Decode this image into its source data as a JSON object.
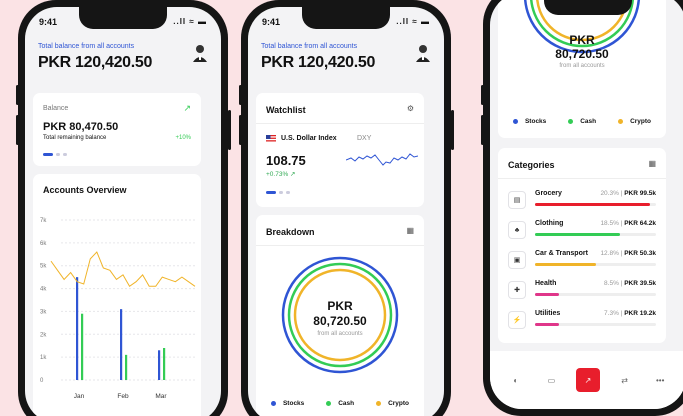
{
  "status": {
    "time": "9:41",
    "icons": "..ll ≈ ▬"
  },
  "balance": {
    "label": "Total balance from all accounts",
    "amount": "PKR 120,420.50"
  },
  "balance_card": {
    "label": "Balance",
    "amount": "PKR 80,470.50",
    "sub": "Total remaining balance",
    "change": "+10%"
  },
  "accounts_overview": {
    "title": "Accounts Overview"
  },
  "chart_data": {
    "type": "bar",
    "title": "Accounts Overview",
    "y_ticks": [
      "7k",
      "6k",
      "5k",
      "4k",
      "3k",
      "2k",
      "1k",
      "0"
    ],
    "x_ticks": [
      "Jan",
      "Feb",
      "Mar"
    ],
    "ylim": [
      0,
      7000
    ],
    "bars": [
      {
        "month": "Jan",
        "blue": 4500,
        "green": 2900
      },
      {
        "month": "Feb",
        "blue": 3100,
        "green": 1100
      },
      {
        "month": "Mar",
        "blue": 1300,
        "green": 1400
      }
    ],
    "line": [
      5200,
      4800,
      4400,
      4700,
      4300,
      4200,
      5300,
      5600,
      4900,
      4800,
      4400,
      4600,
      4100,
      4300,
      4600,
      4100,
      4100,
      4500,
      4400,
      4300,
      4500,
      4300,
      4100
    ],
    "colors": {
      "line": "#f0b429",
      "blue": "#2f55d4",
      "green": "#33cc55"
    }
  },
  "watchlist": {
    "title": "Watchlist",
    "name": "U.S. Dollar Index",
    "ticker": "DXY",
    "value": "108.75",
    "change": "+0.73%"
  },
  "breakdown": {
    "title": "Breakdown",
    "currency": "PKR",
    "amount": "80,720.50",
    "sub": "from all accounts"
  },
  "legend": [
    {
      "label": "Stocks",
      "color": "#2f55d4"
    },
    {
      "label": "Cash",
      "color": "#33cc55"
    },
    {
      "label": "Crypto",
      "color": "#f0b429"
    }
  ],
  "categories": {
    "title": "Categories",
    "items": [
      {
        "name": "Grocery",
        "pct": "20.3%",
        "amount": "PKR 99.5k",
        "fill": 0.95,
        "color": "#e81e2c",
        "icon": "cart-icon",
        "glyph": "▤"
      },
      {
        "name": "Clothing",
        "pct": "18.5%",
        "amount": "PKR 64.2k",
        "fill": 0.7,
        "color": "#33cc55",
        "icon": "shirt-icon",
        "glyph": "♣"
      },
      {
        "name": "Car & Transport",
        "pct": "12.8%",
        "amount": "PKR 50.3k",
        "fill": 0.5,
        "color": "#f0b429",
        "icon": "car-icon",
        "glyph": "▣"
      },
      {
        "name": "Health",
        "pct": "8.5%",
        "amount": "PKR 39.5k",
        "fill": 0.2,
        "color": "#e0368a",
        "icon": "health-icon",
        "glyph": "✚"
      },
      {
        "name": "Utilities",
        "pct": "7.3%",
        "amount": "PKR 19.2k",
        "fill": 0.2,
        "color": "#e0368a",
        "icon": "plug-icon",
        "glyph": "⚡"
      }
    ]
  },
  "separator": "|",
  "nav": [
    {
      "name": "home-icon",
      "glyph": "◐"
    },
    {
      "name": "wallet-icon",
      "glyph": "▭"
    },
    {
      "name": "trend-icon",
      "glyph": "↗"
    },
    {
      "name": "transfer-icon",
      "glyph": "⇄"
    },
    {
      "name": "more-icon",
      "glyph": "•••"
    }
  ]
}
